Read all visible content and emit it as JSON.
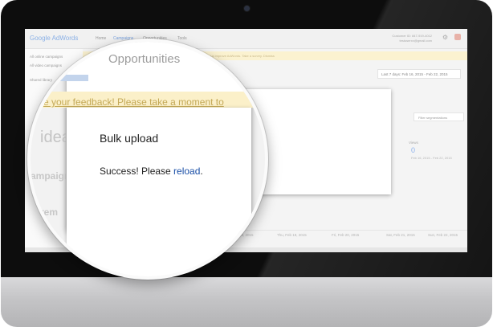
{
  "app": {
    "logo_text": "Google AdWords",
    "nav": [
      "Home",
      "Campaigns",
      "Opportunities",
      "Tools"
    ],
    "account_lines": [
      "Customer ID: 847-919-4012",
      "testuserxx@gmail.com"
    ],
    "icons": {
      "settings": "gear-icon",
      "notifications": "bell-icon"
    }
  },
  "sidebar": {
    "items": [
      "All online campaigns",
      "All video campaigns",
      "Shared library"
    ]
  },
  "banner": {
    "text": "Help us improve AdWords. Take a survey. Dismiss"
  },
  "date_range": {
    "label": "Last 7 days: Feb 16, 2015 - Feb 22, 2015"
  },
  "segments_button": {
    "label": "Filter segmentations"
  },
  "stats": {
    "views_label": "Views",
    "views_value": "0",
    "views_range": "Feb 16, 2015 - Feb 22, 2015"
  },
  "empty_message": "There is nothing to show for this date range",
  "axis_dates": [
    "Feb 18, 2015",
    "Thu, Feb 19, 2015",
    "Fri, Feb 20, 2015",
    "Sat, Feb 21, 2015",
    "Sun, Feb 22, 2015"
  ],
  "magnifier": {
    "page_heading": "Opportunities",
    "feedback_text": "e your feedback! Please take a moment to",
    "ideas_heading": "idea",
    "campaign_heading": "ampaign",
    "rem_heading": "rem",
    "modal": {
      "title": "Bulk upload",
      "message_prefix": "Success! Please ",
      "link_text": "reload",
      "message_suffix": "."
    }
  },
  "colors": {
    "link": "#1a4fa7",
    "feedback_banner": "#fbf0c9",
    "accent_blue": "#8fb4ec"
  }
}
